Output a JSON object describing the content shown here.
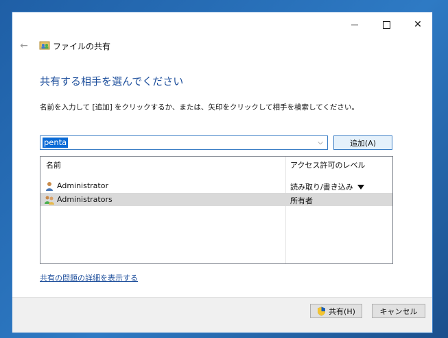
{
  "window": {
    "title": "ファイルの共有"
  },
  "titlebar": {
    "minimize_glyph": "",
    "close_glyph": "✕"
  },
  "nav": {
    "back_glyph": "←"
  },
  "main": {
    "heading": "共有する相手を選んでください",
    "instruction": "名前を入力して [追加] をクリックするか、または、矢印をクリックして相手を検索してください。",
    "combo": {
      "value": "penta",
      "arrow_glyph": "⌵"
    },
    "add_button_label": "追加(A)",
    "list": {
      "columns": [
        "名前",
        "アクセス許可のレベル"
      ],
      "rows": [
        {
          "name": "Administrator",
          "access": "読み取り/書き込み",
          "icon": "user-icon",
          "has_dropdown": true,
          "selected": false
        },
        {
          "name": "Administrators",
          "access": "所有者",
          "icon": "group-icon",
          "has_dropdown": false,
          "selected": true
        }
      ]
    },
    "help_link": "共有の問題の詳細を表示する"
  },
  "footer": {
    "share_button_label": "共有(H)",
    "cancel_button_label": "キャンセル"
  },
  "colors": {
    "heading": "#1e4f9c",
    "selection_highlight": "#0a6ad6",
    "selected_row": "#d9d9d9",
    "footer_bg": "#f0f0f0"
  }
}
